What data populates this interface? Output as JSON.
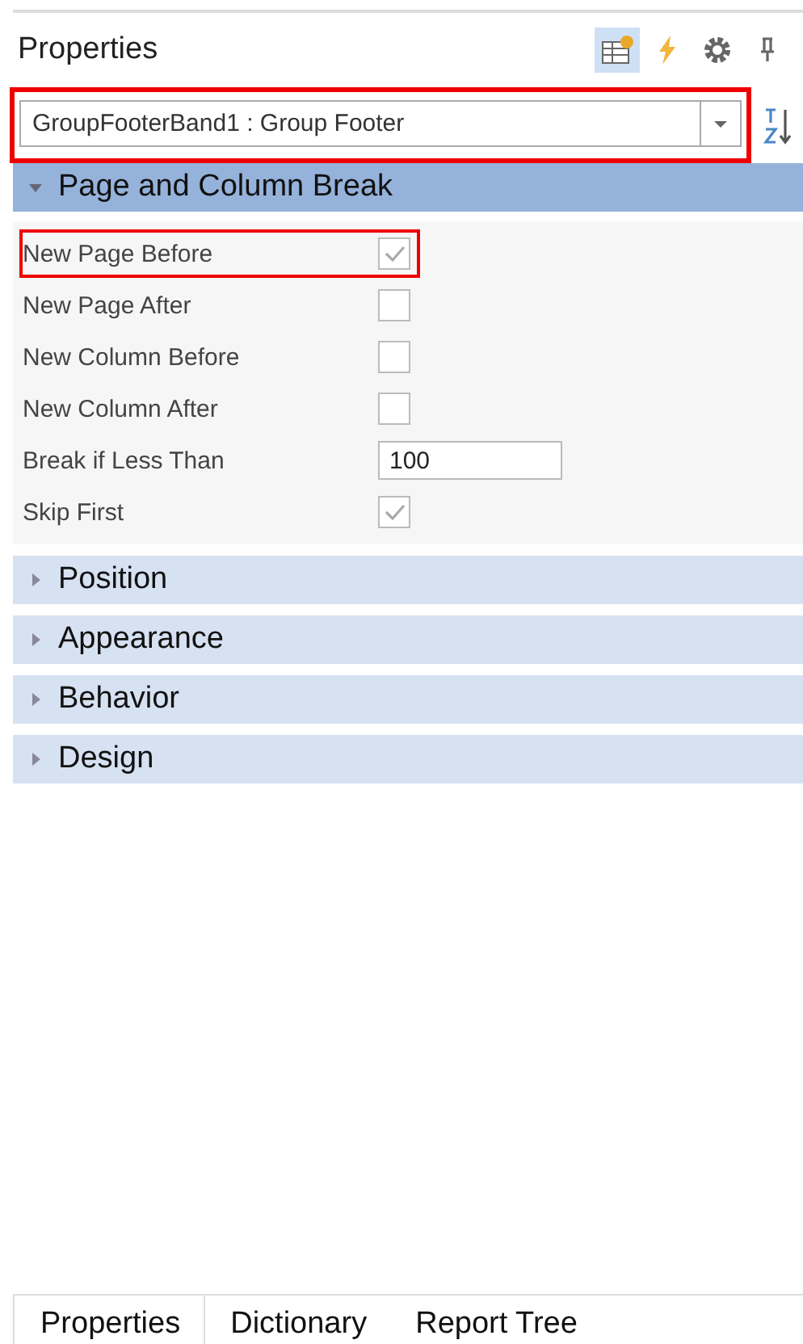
{
  "panel": {
    "title": "Properties"
  },
  "toolbar": [
    {
      "kind": "categorized",
      "selected": true
    },
    {
      "kind": "events",
      "selected": false
    },
    {
      "kind": "settings",
      "selected": false
    },
    {
      "kind": "pin",
      "selected": false
    }
  ],
  "object_selector": {
    "value": "GroupFooterBand1 : Group Footer",
    "highlighted": true
  },
  "sections": [
    {
      "title": "Page and Column Break",
      "expanded": true,
      "rows": [
        {
          "label": "New Page Before",
          "kind": "checkbox",
          "checked": true,
          "highlighted": true
        },
        {
          "label": "New Page After",
          "kind": "checkbox",
          "checked": false,
          "highlighted": false
        },
        {
          "label": "New Column Before",
          "kind": "checkbox",
          "checked": false,
          "highlighted": false
        },
        {
          "label": "New Column After",
          "kind": "checkbox",
          "checked": false,
          "highlighted": false
        },
        {
          "label": "Break if Less Than",
          "kind": "text",
          "value": "100",
          "highlighted": false
        },
        {
          "label": "Skip First",
          "kind": "checkbox",
          "checked": true,
          "highlighted": false
        }
      ]
    },
    {
      "title": "Position",
      "expanded": false
    },
    {
      "title": "Appearance",
      "expanded": false
    },
    {
      "title": "Behavior",
      "expanded": false
    },
    {
      "title": "Design",
      "expanded": false
    }
  ],
  "bottom_tabs": [
    {
      "label": "Properties",
      "selected": true
    },
    {
      "label": "Dictionary",
      "selected": false
    },
    {
      "label": "Report Tree",
      "selected": false
    }
  ]
}
